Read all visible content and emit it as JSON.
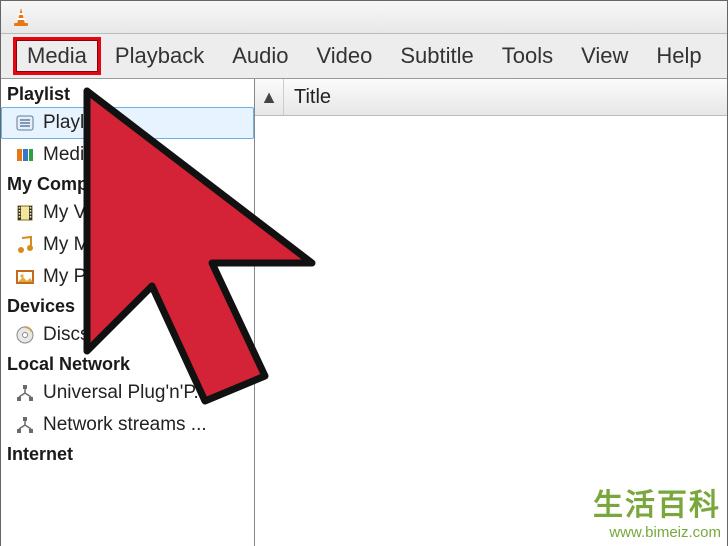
{
  "menubar": {
    "items": [
      {
        "label": "Media"
      },
      {
        "label": "Playback"
      },
      {
        "label": "Audio"
      },
      {
        "label": "Video"
      },
      {
        "label": "Subtitle"
      },
      {
        "label": "Tools"
      },
      {
        "label": "View"
      },
      {
        "label": "Help"
      }
    ],
    "highlightedIndex": 0
  },
  "sidebar": {
    "groups": [
      {
        "header": "Playlist",
        "items": [
          {
            "label": "Playlist",
            "icon": "playlist-icon",
            "selected": true
          },
          {
            "label": "Media Library",
            "icon": "media-library-icon"
          }
        ]
      },
      {
        "header": "My Computer",
        "items": [
          {
            "label": "My Videos",
            "icon": "film-icon"
          },
          {
            "label": "My Music",
            "icon": "music-note-icon"
          },
          {
            "label": "My Pictures",
            "icon": "picture-icon"
          }
        ]
      },
      {
        "header": "Devices",
        "items": [
          {
            "label": "Discs",
            "icon": "disc-icon"
          }
        ]
      },
      {
        "header": "Local Network",
        "items": [
          {
            "label": "Universal Plug'n'P...",
            "icon": "upnp-icon"
          },
          {
            "label": "Network streams ...",
            "icon": "network-icon"
          }
        ]
      },
      {
        "header": "Internet",
        "items": []
      }
    ]
  },
  "content": {
    "column_header": "Title",
    "sort_indicator": "▲"
  },
  "watermark": {
    "line1": "生活百科",
    "line2": "www.bimeiz.com"
  },
  "overlay": {
    "cursor_color": "#d42336",
    "cursor_stroke": "#111"
  }
}
